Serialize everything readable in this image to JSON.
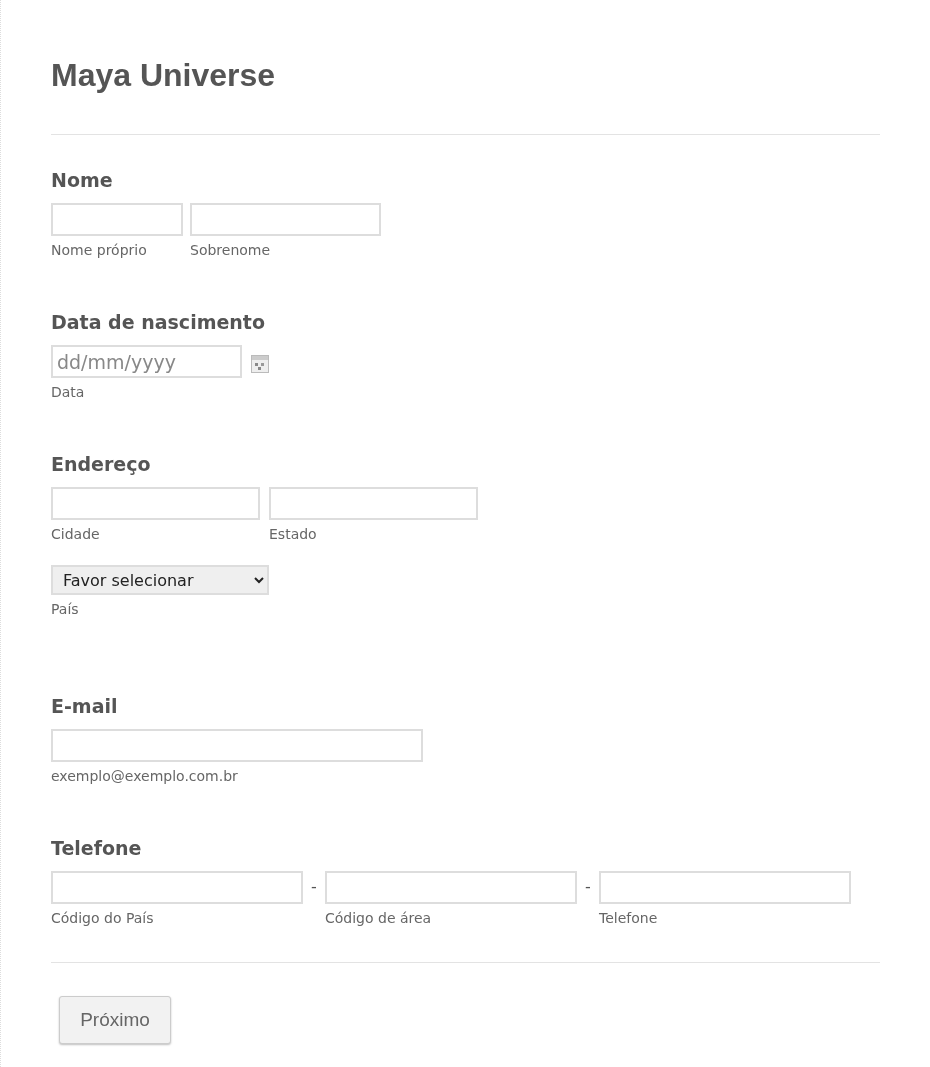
{
  "form": {
    "title": "Maya Universe"
  },
  "sections": [
    {
      "kind": "name",
      "label": "Nome",
      "fields": [
        {
          "sublabel": "Nome próprio"
        },
        {
          "sublabel": "Sobrenome"
        }
      ]
    },
    {
      "kind": "date",
      "label": "Data de nascimento",
      "fields": [
        {
          "placeholder": "dd/mm/yyyy",
          "sublabel": "Data"
        }
      ]
    },
    {
      "kind": "address",
      "label": "Endereço",
      "fields": [
        {
          "sublabel": "Cidade"
        },
        {
          "sublabel": "Estado"
        }
      ],
      "select": {
        "value": "Favor selecionar",
        "sublabel": "País"
      }
    },
    {
      "kind": "email",
      "label": "E-mail",
      "fields": [
        {
          "sublabel": "exemplo@exemplo.com.br"
        }
      ]
    },
    {
      "kind": "phone",
      "label": "Telefone",
      "fields": [
        {
          "sublabel": "Código do País"
        },
        {
          "separator": "-",
          "sublabel": "Código de área"
        },
        {
          "separator": "-",
          "sublabel": "Telefone"
        }
      ]
    }
  ],
  "buttons": [
    {
      "label": "Próximo"
    }
  ]
}
